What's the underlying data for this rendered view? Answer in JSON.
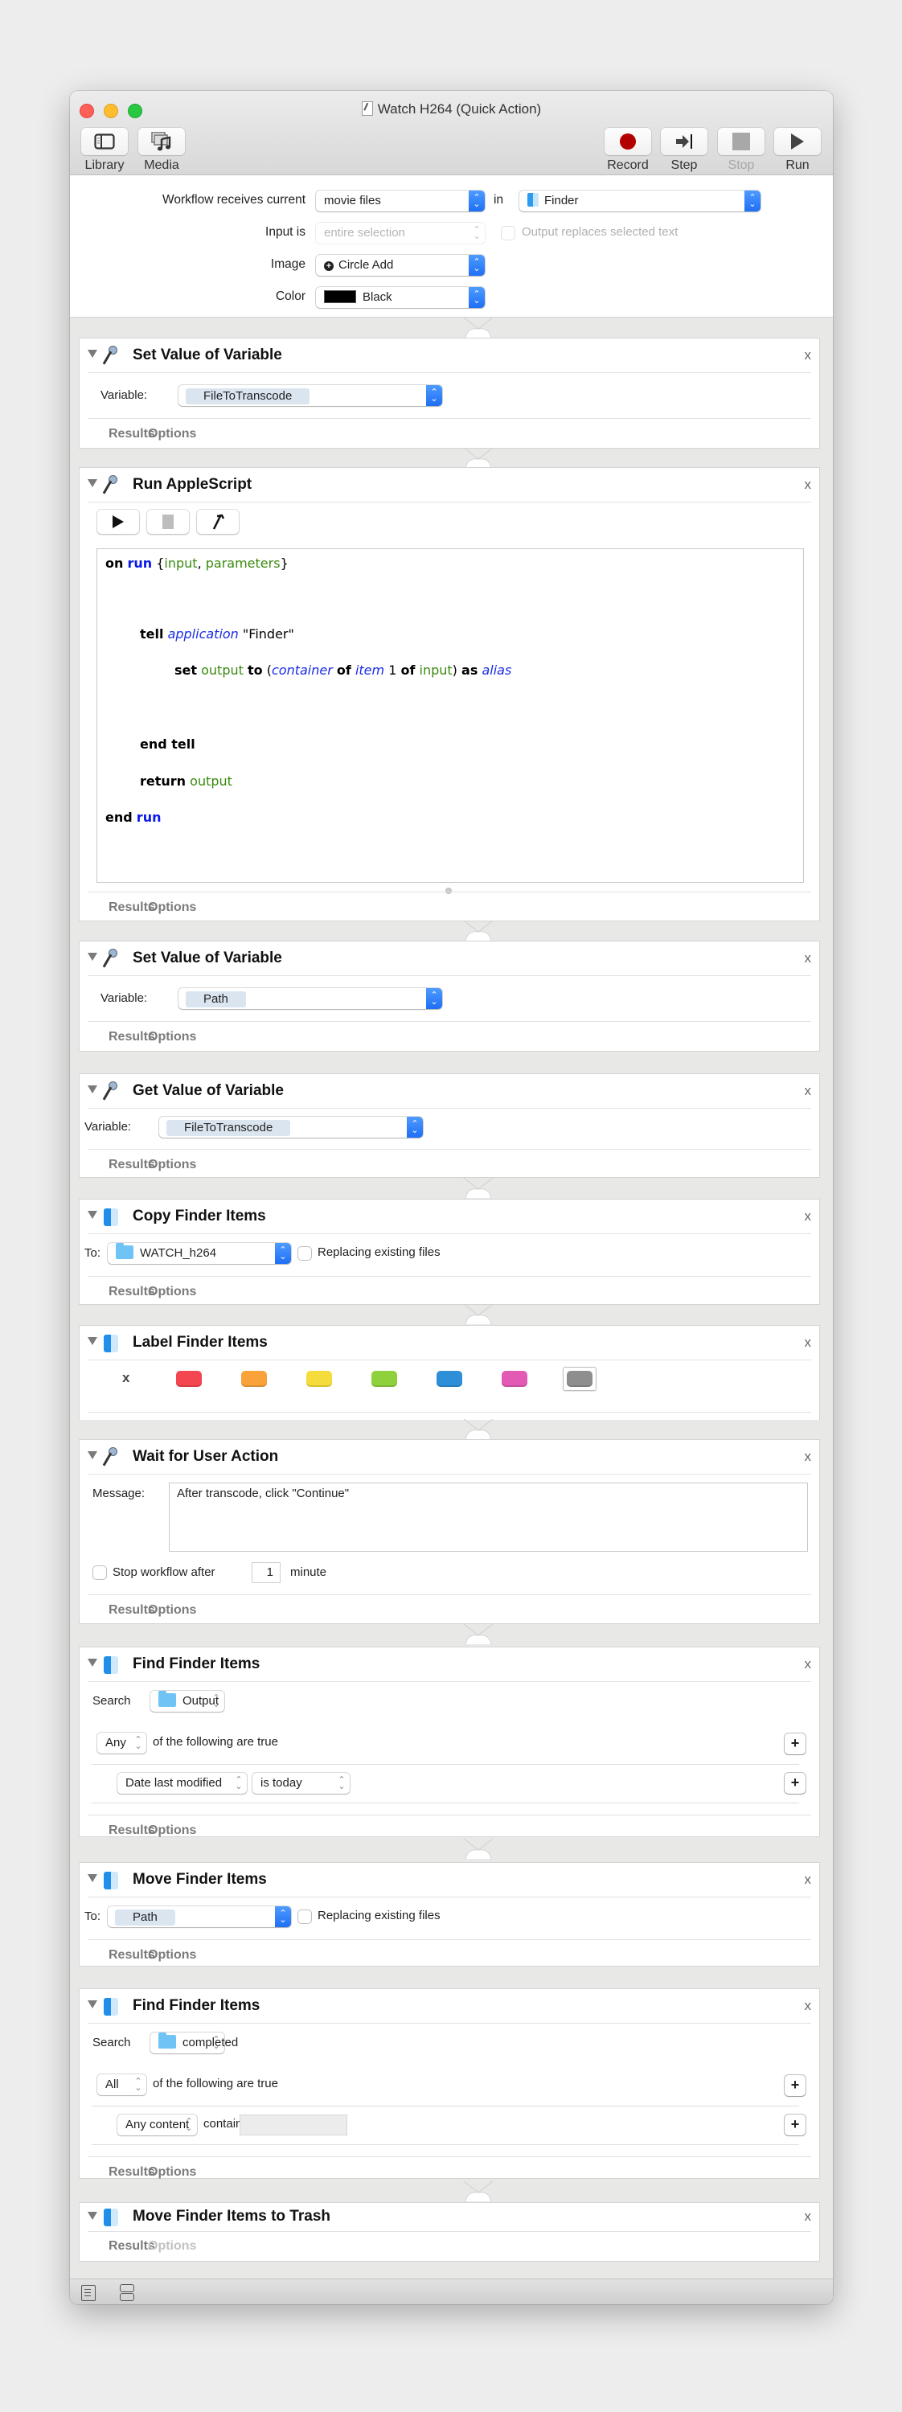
{
  "window": {
    "title": "Watch H264 (Quick Action)",
    "toolbar_left": [
      {
        "label": "Library",
        "icon": "sidebar-icon"
      },
      {
        "label": "Media",
        "icon": "media-icon"
      }
    ],
    "toolbar_right": [
      {
        "label": "Record",
        "icon": "record-icon",
        "enabled": true
      },
      {
        "label": "Step",
        "icon": "step-icon",
        "enabled": true
      },
      {
        "label": "Stop",
        "icon": "stop-icon",
        "enabled": false
      },
      {
        "label": "Run",
        "icon": "run-icon",
        "enabled": true
      }
    ]
  },
  "header": {
    "receives_label": "Workflow receives current",
    "receives_value": "movie files",
    "in_label": "in",
    "in_value": "Finder",
    "input_is_label": "Input is",
    "input_is_value": "entire selection",
    "output_replaces_label": "Output replaces selected text",
    "image_label": "Image",
    "image_value": "Circle Add",
    "color_label": "Color",
    "color_value": "Black",
    "color_hex": "#000000"
  },
  "common": {
    "results_tab": "Results",
    "options_tab": "Options",
    "close": "x",
    "variable_label": "Variable:",
    "to_label": "To:",
    "replacing_label": "Replacing existing files",
    "search_label": "Search",
    "following_true": "of the following are true"
  },
  "actions": {
    "a1": {
      "title": "Set Value of Variable",
      "variable": "FileToTranscode"
    },
    "a2": {
      "title": "Run AppleScript",
      "code_lines": {
        "l1": {
          "on": "on",
          "run": "run",
          "lb": " {",
          "input": "input",
          "comma": ", ",
          "parameters": "parameters",
          "rb": "}"
        },
        "l2": {
          "tell": "tell",
          "application": "application",
          "finder": "\"Finder\""
        },
        "l3": {
          "set": "set",
          "output": "output",
          "to": "to",
          "lp": "(",
          "container": "container",
          "of1": "of",
          "item": "item",
          "one": "1",
          "of2": "of",
          "input": "input",
          "rp": ")",
          "as": "as",
          "alias": "alias"
        },
        "l4": {
          "end_tell": "end tell"
        },
        "l5": {
          "return": "return",
          "output": "output"
        },
        "l6": {
          "end": "end",
          "run": "run"
        }
      }
    },
    "a3": {
      "title": "Set Value of Variable",
      "variable": "Path"
    },
    "a4": {
      "title": "Get Value of Variable",
      "variable": "FileToTranscode"
    },
    "a5": {
      "title": "Copy Finder Items",
      "destination": "WATCH_h264"
    },
    "a6": {
      "title": "Label Finder Items",
      "none_label": "x",
      "colors": [
        "#f44650",
        "#f9a23a",
        "#f5dc3c",
        "#8fd13d",
        "#2d8fd8",
        "#e25ab3",
        "#8e8e8e"
      ],
      "selected_index": 6
    },
    "a7": {
      "title": "Wait for User Action",
      "message_label": "Message:",
      "message": "After transcode, click \"Continue\"",
      "stop_label": "Stop workflow after",
      "stop_value": "1",
      "stop_unit": "minute"
    },
    "a8": {
      "title": "Find Finder Items",
      "search_location": "Output",
      "match": "Any",
      "criterion_field": "Date last modified",
      "criterion_op": "is today"
    },
    "a9": {
      "title": "Move Finder Items",
      "destination": "Path"
    },
    "a10": {
      "title": "Find Finder Items",
      "search_location": "completed",
      "match": "All",
      "criterion_field": "Any content",
      "criterion_op": "contains",
      "criterion_value": ""
    },
    "a11": {
      "title": "Move Finder Items to Trash"
    }
  }
}
